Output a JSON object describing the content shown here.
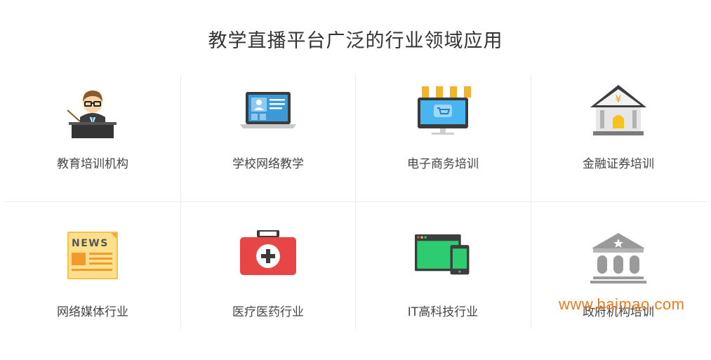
{
  "title": "教学直播平台广泛的行业领域应用",
  "industries": [
    {
      "label": "教育培训机构",
      "icon": "teacher-icon"
    },
    {
      "label": "学校网络教学",
      "icon": "laptop-icon"
    },
    {
      "label": "电子商务培训",
      "icon": "storefront-icon"
    },
    {
      "label": "金融证券培训",
      "icon": "bank-icon"
    },
    {
      "label": "网络媒体行业",
      "icon": "news-icon"
    },
    {
      "label": "医疗医药行业",
      "icon": "medical-kit-icon"
    },
    {
      "label": "IT高科技行业",
      "icon": "devices-icon"
    },
    {
      "label": "政府机构培训",
      "icon": "government-icon"
    }
  ],
  "watermark": "www.baimao.com"
}
